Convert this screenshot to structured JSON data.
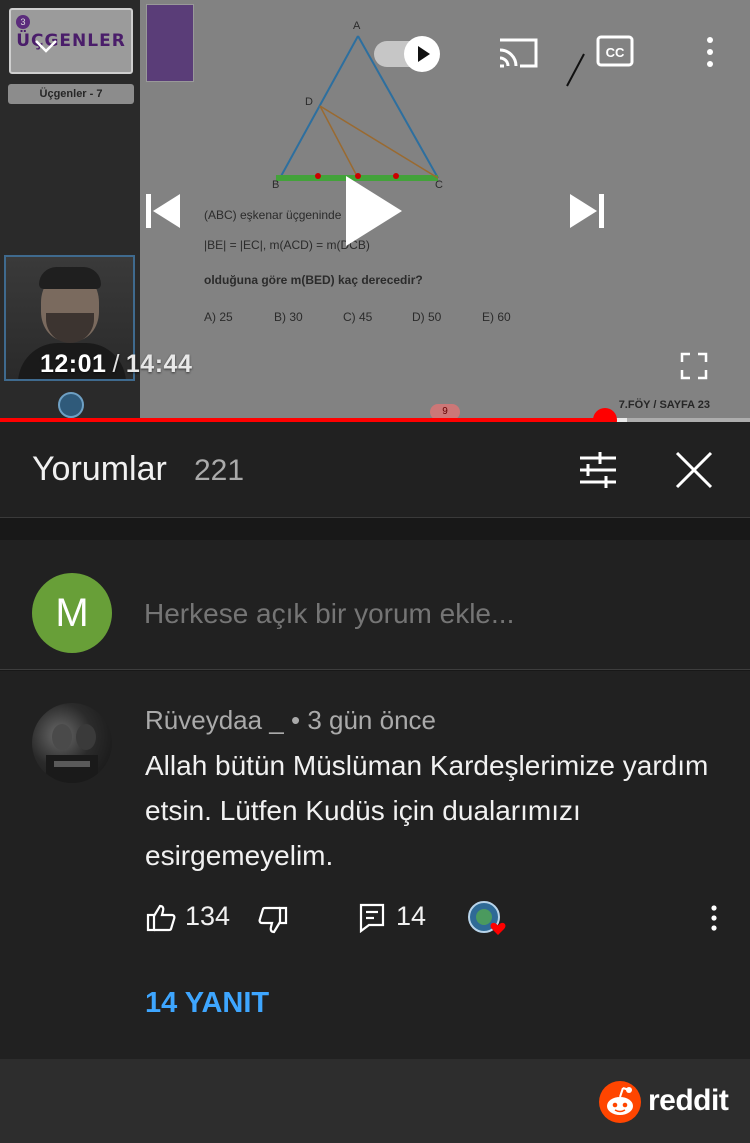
{
  "player": {
    "course_badge": "ÜÇGENLER",
    "badge_number": "3",
    "lesson_tag": "Üçgenler - 7",
    "board": {
      "vertex_a": "A",
      "vertex_b": "B",
      "vertex_c": "C",
      "vertex_d": "D",
      "question_line1": "(ABC) eşkenar üçgeninde",
      "question_line2": "|BE| = |EC|,  m(ACD) = m(DCB)",
      "question_line3": "olduğuna göre m(BED) kaç derecedir?",
      "options": [
        "A) 25",
        "B) 30",
        "C) 45",
        "D) 50",
        "E) 60"
      ],
      "page_ref": "7.FÖY / SAYFA 23",
      "page_number": "9"
    },
    "current_time": "12:01",
    "separator": "/",
    "duration": "14:44",
    "progress_played_fraction": 0.806,
    "progress_buffered_fraction": 0.836,
    "icons": {
      "collapse": "chevron-down-icon",
      "autoplay": "autoplay-toggle",
      "cast": "cast-icon",
      "captions": "cc-icon",
      "more": "more-vert-icon",
      "previous": "skip-previous-icon",
      "play": "play-icon",
      "next": "skip-next-icon",
      "fullscreen": "fullscreen-icon"
    },
    "accent_color": "#ff0000"
  },
  "comments": {
    "title": "Yorumlar",
    "count": "221",
    "add_placeholder": "Herkese açık bir yorum ekle...",
    "my_avatar_letter": "M",
    "my_avatar_color": "#689f38",
    "items": [
      {
        "author": "Rüveydaa _",
        "meta": " • 3 gün önce",
        "text": "Allah bütün Müslüman Kardeşlerimize yardım etsin. Lütfen Kudüs için dualarımızı esirgemeyelim.",
        "likes": "134",
        "replies_count": "14",
        "replies_label": "14 YANIT"
      }
    ]
  },
  "footer": {
    "brand": "reddit",
    "brand_color": "#ff4500"
  }
}
